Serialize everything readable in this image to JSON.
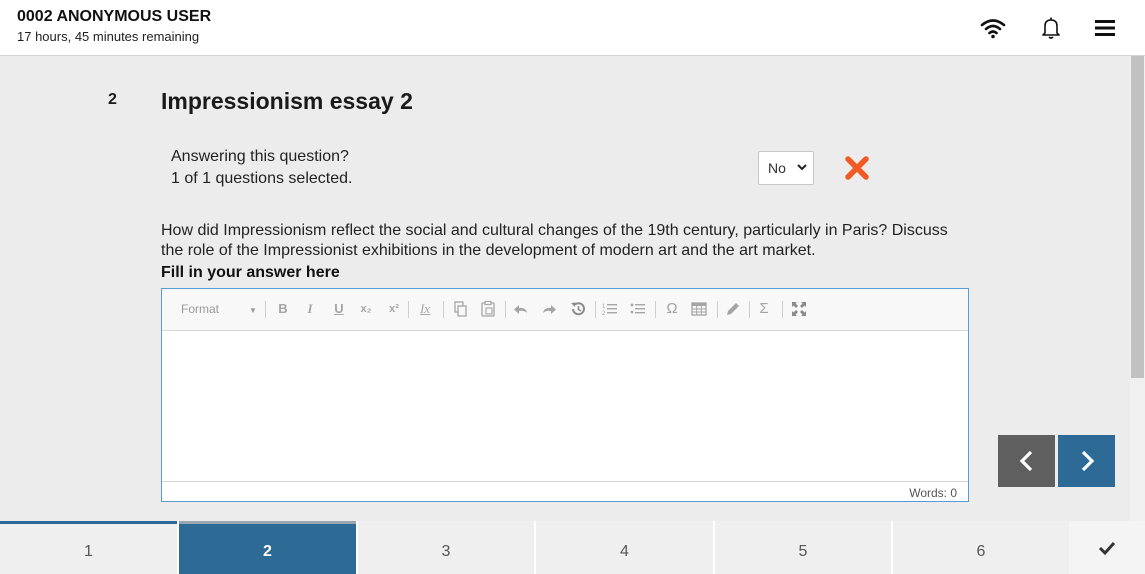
{
  "header": {
    "user_name": "0002 ANONYMOUS USER",
    "time_remaining": "17 hours, 45 minutes remaining",
    "icons": [
      "wifi-icon",
      "bell-icon",
      "menu-icon"
    ]
  },
  "question": {
    "number": "2",
    "title": "Impressionism essay 2",
    "answering_label": "Answering this question?",
    "selected_text": "1 of 1 questions selected.",
    "answering_value": "No",
    "body": "How did Impressionism reflect the social and cultural changes of the 19th century, particularly in Paris? Discuss the role of the Impressionist exhibitions in the development of modern art and the art market.",
    "fill_label": "Fill in your answer here"
  },
  "editor": {
    "format_label": "Format",
    "toolbar_buttons": [
      "B",
      "I",
      "U",
      "x₂",
      "x²",
      "Ix",
      "copy",
      "paste",
      "undo",
      "redo",
      "history",
      "1≡",
      "•≡",
      "Ω",
      "table",
      "pencil",
      "Σ",
      "fullscreen"
    ],
    "word_count": "Words: 0"
  },
  "navigation": {
    "tabs": [
      "1",
      "2",
      "3",
      "4",
      "5",
      "6"
    ],
    "active_tab": "2"
  },
  "colors": {
    "accent": "#2d6a96",
    "danger": "#f15a24",
    "prev_button": "#5f5f5f"
  }
}
